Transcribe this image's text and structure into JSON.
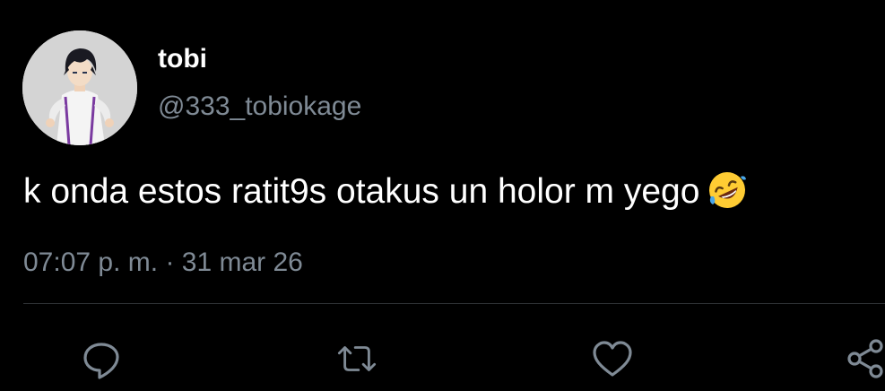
{
  "tweet": {
    "author": {
      "display_name": "tobi",
      "handle": "@333_tobiokage",
      "avatar_icon": "anime-character-avatar"
    },
    "text": "k onda estos ratit9s otakus un holor m yego",
    "emoji": "rolling-on-the-floor-laughing",
    "time": "07:07 p. m.",
    "separator": "·",
    "date": "31 mar 26"
  },
  "actions": {
    "reply_icon": "reply-icon",
    "retweet_icon": "retweet-icon",
    "like_icon": "heart-icon",
    "share_icon": "share-icon"
  },
  "colors": {
    "background": "#000000",
    "primary_text": "#ffffff",
    "secondary_text": "#7f8a95",
    "icon": "#7f8a95",
    "divider": "#2f3336"
  }
}
